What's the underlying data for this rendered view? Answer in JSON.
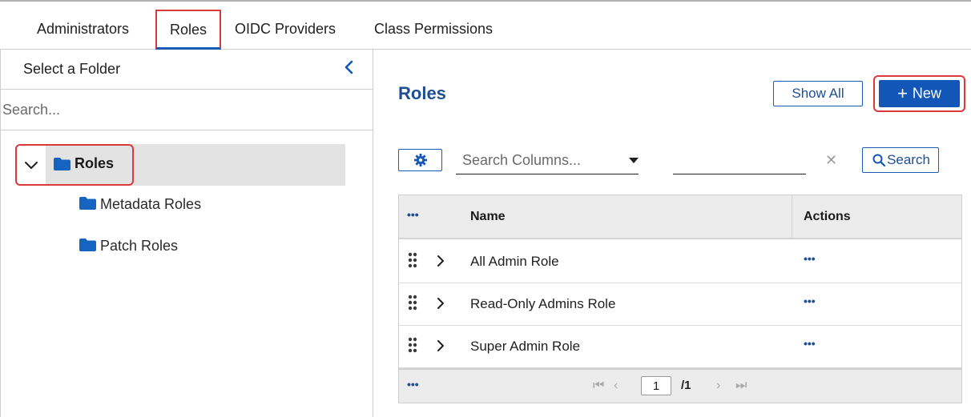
{
  "tabs": [
    {
      "label": "Administrators",
      "active": false
    },
    {
      "label": "Roles",
      "active": true
    },
    {
      "label": "OIDC Providers",
      "active": false
    },
    {
      "label": "Class Permissions",
      "active": false
    }
  ],
  "sidebar": {
    "title": "Select a Folder",
    "search_placeholder": "Search...",
    "tree": {
      "root": {
        "label": "Roles",
        "expanded": true,
        "selected": true
      },
      "children": [
        {
          "label": "Metadata Roles"
        },
        {
          "label": "Patch Roles"
        }
      ]
    }
  },
  "main": {
    "title": "Roles",
    "show_all_label": "Show All",
    "new_label": "New",
    "filter": {
      "column_placeholder": "Search Columns...",
      "value": "",
      "search_label": "Search"
    },
    "grid": {
      "columns": [
        "Name",
        "Actions"
      ],
      "rows": [
        {
          "name": "All Admin Role"
        },
        {
          "name": "Read-Only Admins Role"
        },
        {
          "name": "Super Admin Role"
        }
      ],
      "pagination": {
        "current_page": "1",
        "total_pages": "/1"
      }
    }
  },
  "colors": {
    "accent": "#1256b7",
    "title_blue": "#1d4f91",
    "highlight_red": "#d93a3a",
    "folder": "#1565c0"
  }
}
